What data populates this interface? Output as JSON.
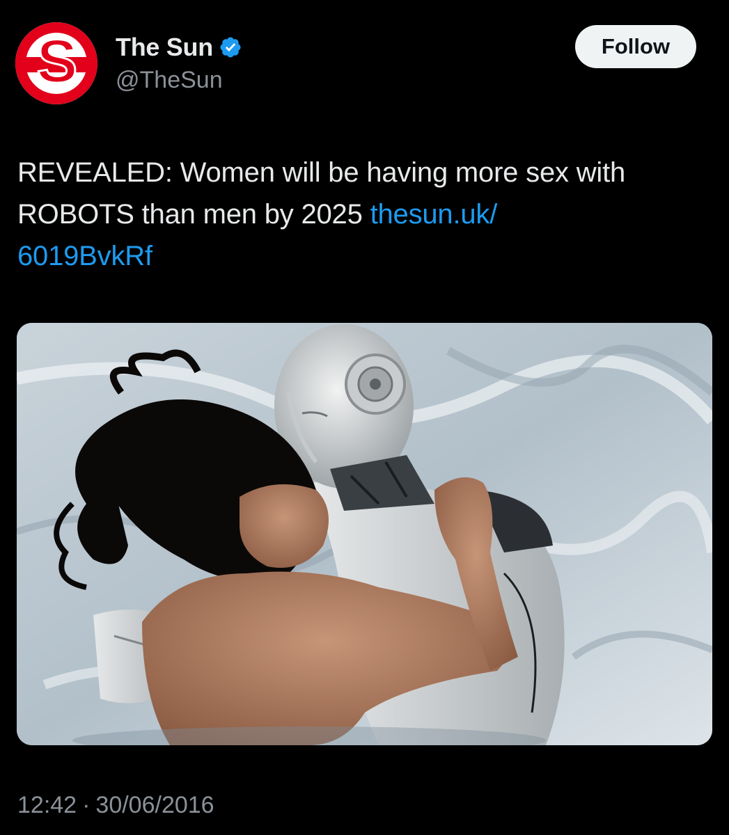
{
  "author": {
    "display_name": "The Sun",
    "handle": "@TheSun",
    "avatar_letter": "S",
    "verified_icon": "verified-badge-icon",
    "verified_color": "#1d9bf0"
  },
  "actions": {
    "follow_label": "Follow"
  },
  "tweet": {
    "text": "REVEALED: Women will be having more sex with ROBOTS than men by 2025 ",
    "link": "thesun.uk/\n6019BvkRf",
    "link_color": "#1d9bf0"
  },
  "meta": {
    "time": "12:42",
    "separator": "·",
    "date": "30/06/2016"
  },
  "colors": {
    "background": "#000000",
    "text": "#e7e9ea",
    "muted": "#8b9198",
    "brand_red": "#e2001a"
  }
}
